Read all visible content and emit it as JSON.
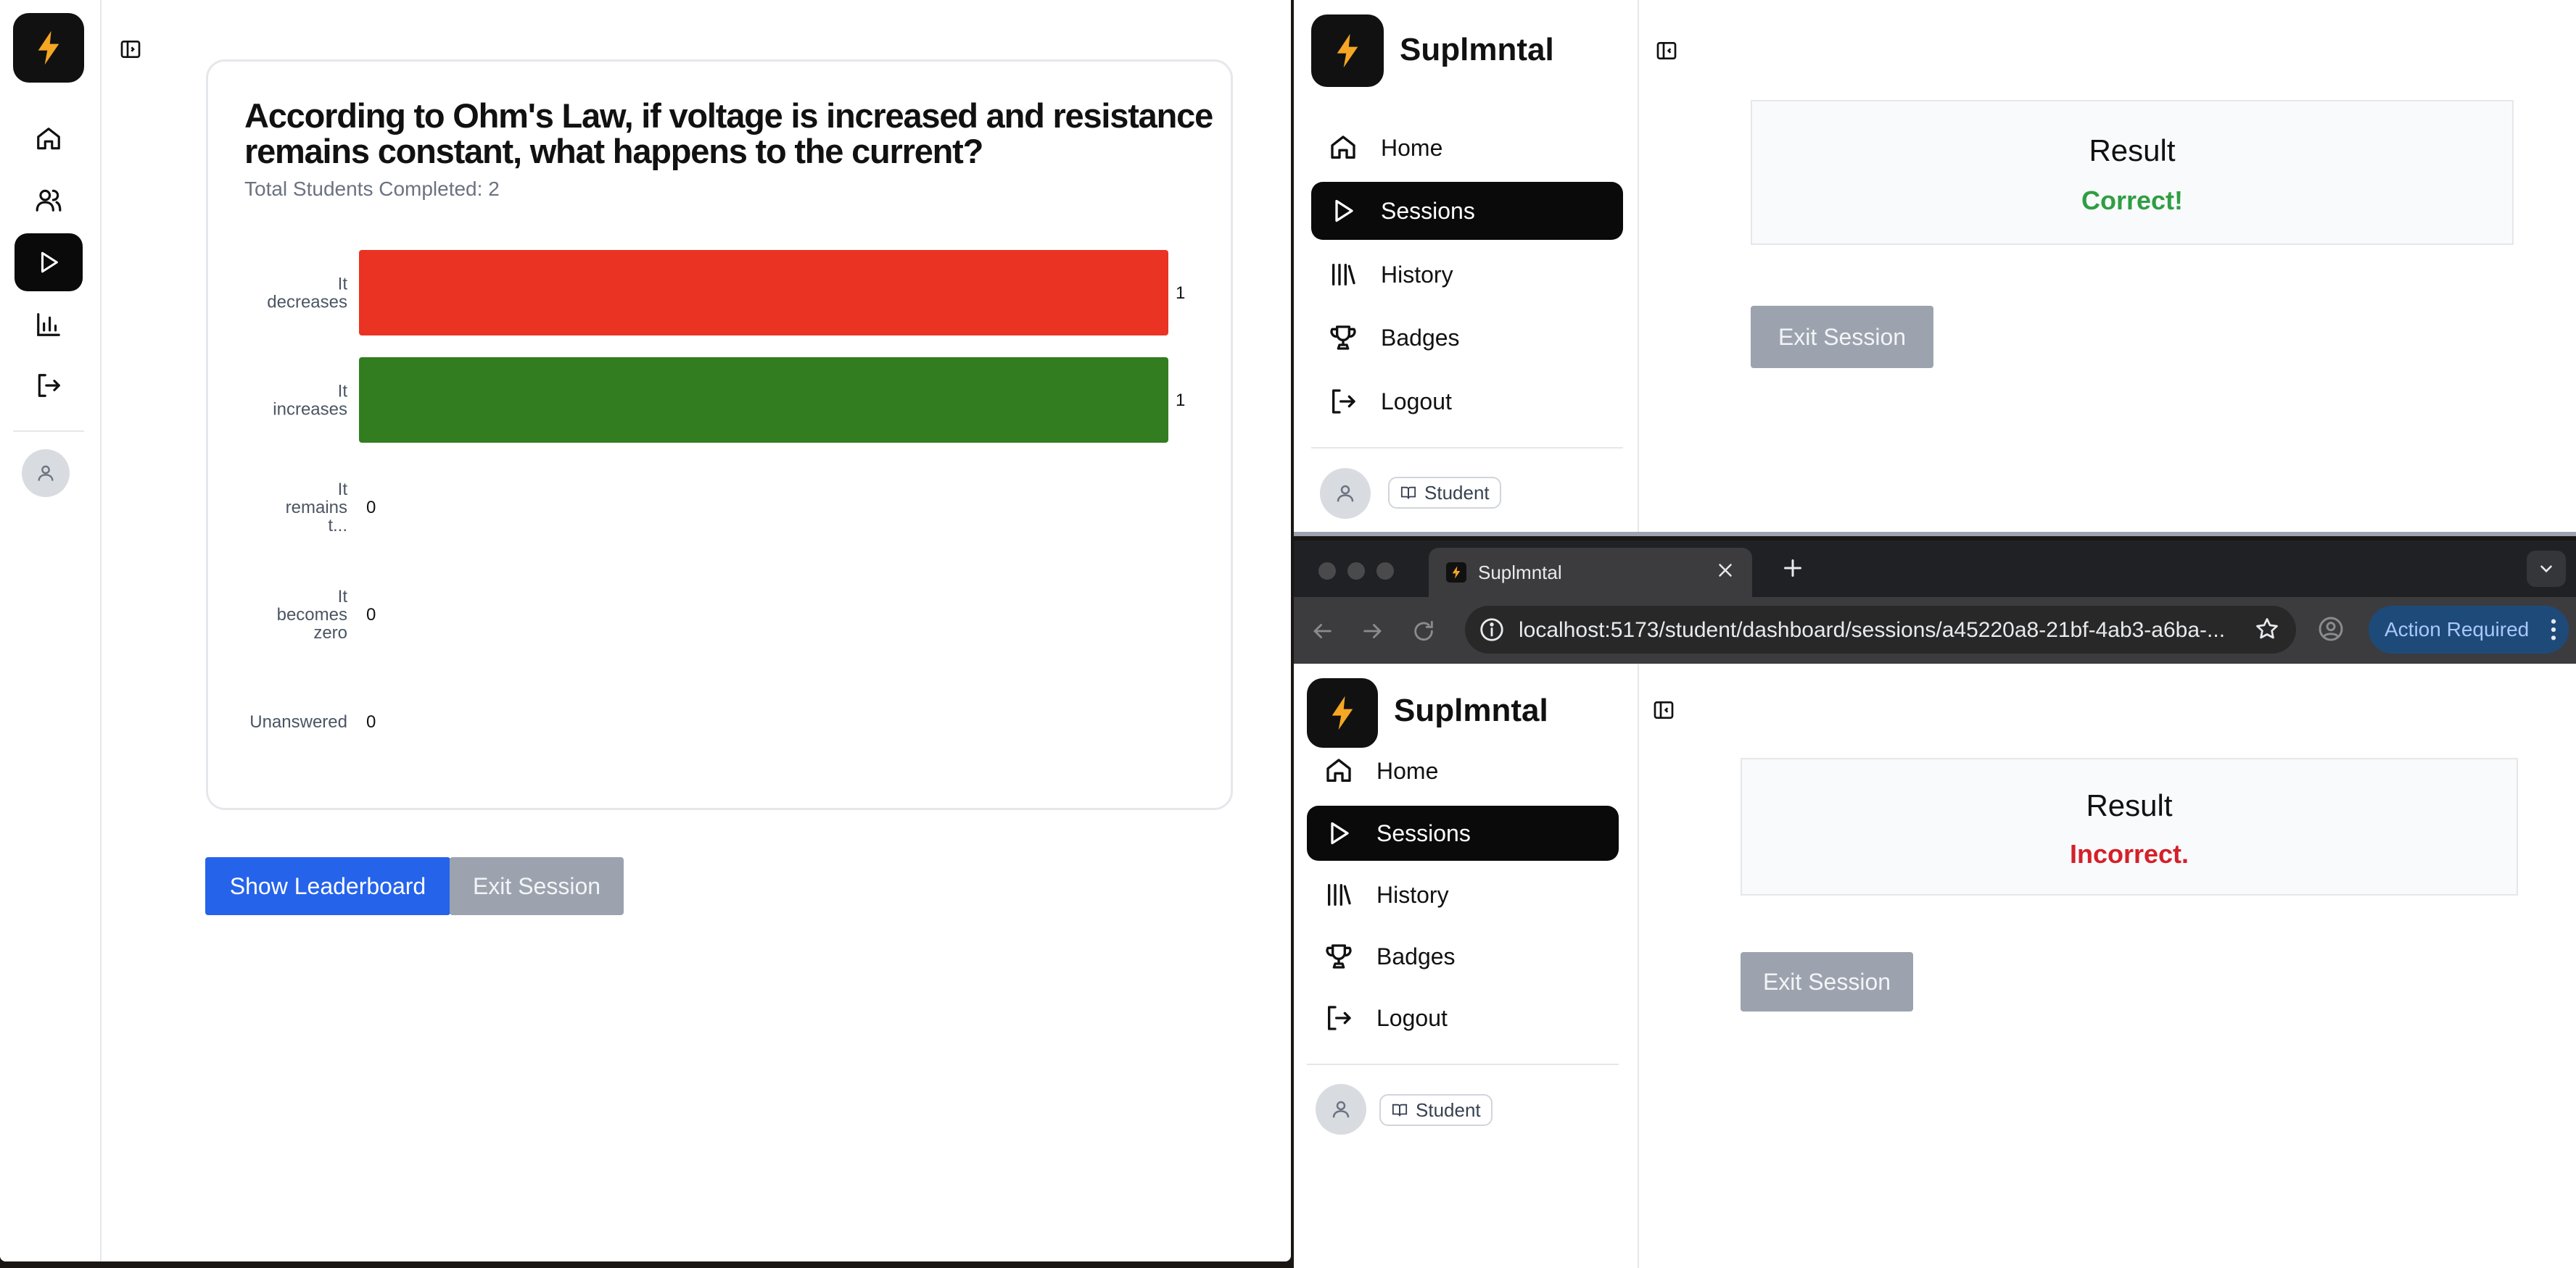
{
  "left_window": {
    "rail_icons": [
      "home-icon",
      "users-icon",
      "play-icon",
      "bar-chart-icon",
      "logout-icon"
    ],
    "question": "According to Ohm's Law, if voltage is increased and resistance remains constant, what happens to the current?",
    "total_label": "Total Students Completed: 2",
    "buttons": {
      "leaderboard": "Show Leaderboard",
      "exit": "Exit Session"
    },
    "colors": {
      "primary": "#2563eb",
      "disabled": "#9ca3af",
      "active_nav": "#0a0a0a"
    }
  },
  "chart_data": {
    "type": "bar",
    "orientation": "horizontal",
    "categories": [
      [
        "It",
        "decreases"
      ],
      [
        "It",
        "increases"
      ],
      [
        "It",
        "remains",
        "t..."
      ],
      [
        "It",
        "becomes",
        "zero"
      ],
      [
        "Unanswered"
      ]
    ],
    "values": [
      1,
      1,
      0,
      0,
      0
    ],
    "colors": [
      "#ea3323",
      "#327d1f",
      "#9ca3af",
      "#9ca3af",
      "#9ca3af"
    ],
    "xlim": [
      0,
      1
    ],
    "grid": false,
    "legend": false,
    "title": "",
    "xlabel": "",
    "ylabel": ""
  },
  "right_top": {
    "brand": "Suplmntal",
    "nav": [
      {
        "label": "Home",
        "icon": "home-icon"
      },
      {
        "label": "Sessions",
        "icon": "play-icon",
        "active": true
      },
      {
        "label": "History",
        "icon": "library-icon"
      },
      {
        "label": "Badges",
        "icon": "trophy-icon"
      },
      {
        "label": "Logout",
        "icon": "logout-icon"
      }
    ],
    "role": "Student",
    "result": {
      "title": "Result",
      "value": "Correct!",
      "color": "#2f9e44"
    },
    "exit": "Exit Session"
  },
  "browser": {
    "tab_title": "Suplmntal",
    "url": "localhost:5173/student/dashboard/sessions/a45220a8-21bf-4ab3-a6ba-...",
    "action": "Action Required"
  },
  "right_bottom": {
    "brand": "Suplmntal",
    "nav": [
      {
        "label": "Home",
        "icon": "home-icon"
      },
      {
        "label": "Sessions",
        "icon": "play-icon",
        "active": true
      },
      {
        "label": "History",
        "icon": "library-icon"
      },
      {
        "label": "Badges",
        "icon": "trophy-icon"
      },
      {
        "label": "Logout",
        "icon": "logout-icon"
      }
    ],
    "role": "Student",
    "result": {
      "title": "Result",
      "value": "Incorrect.",
      "color": "#d4202a"
    },
    "exit": "Exit Session"
  }
}
